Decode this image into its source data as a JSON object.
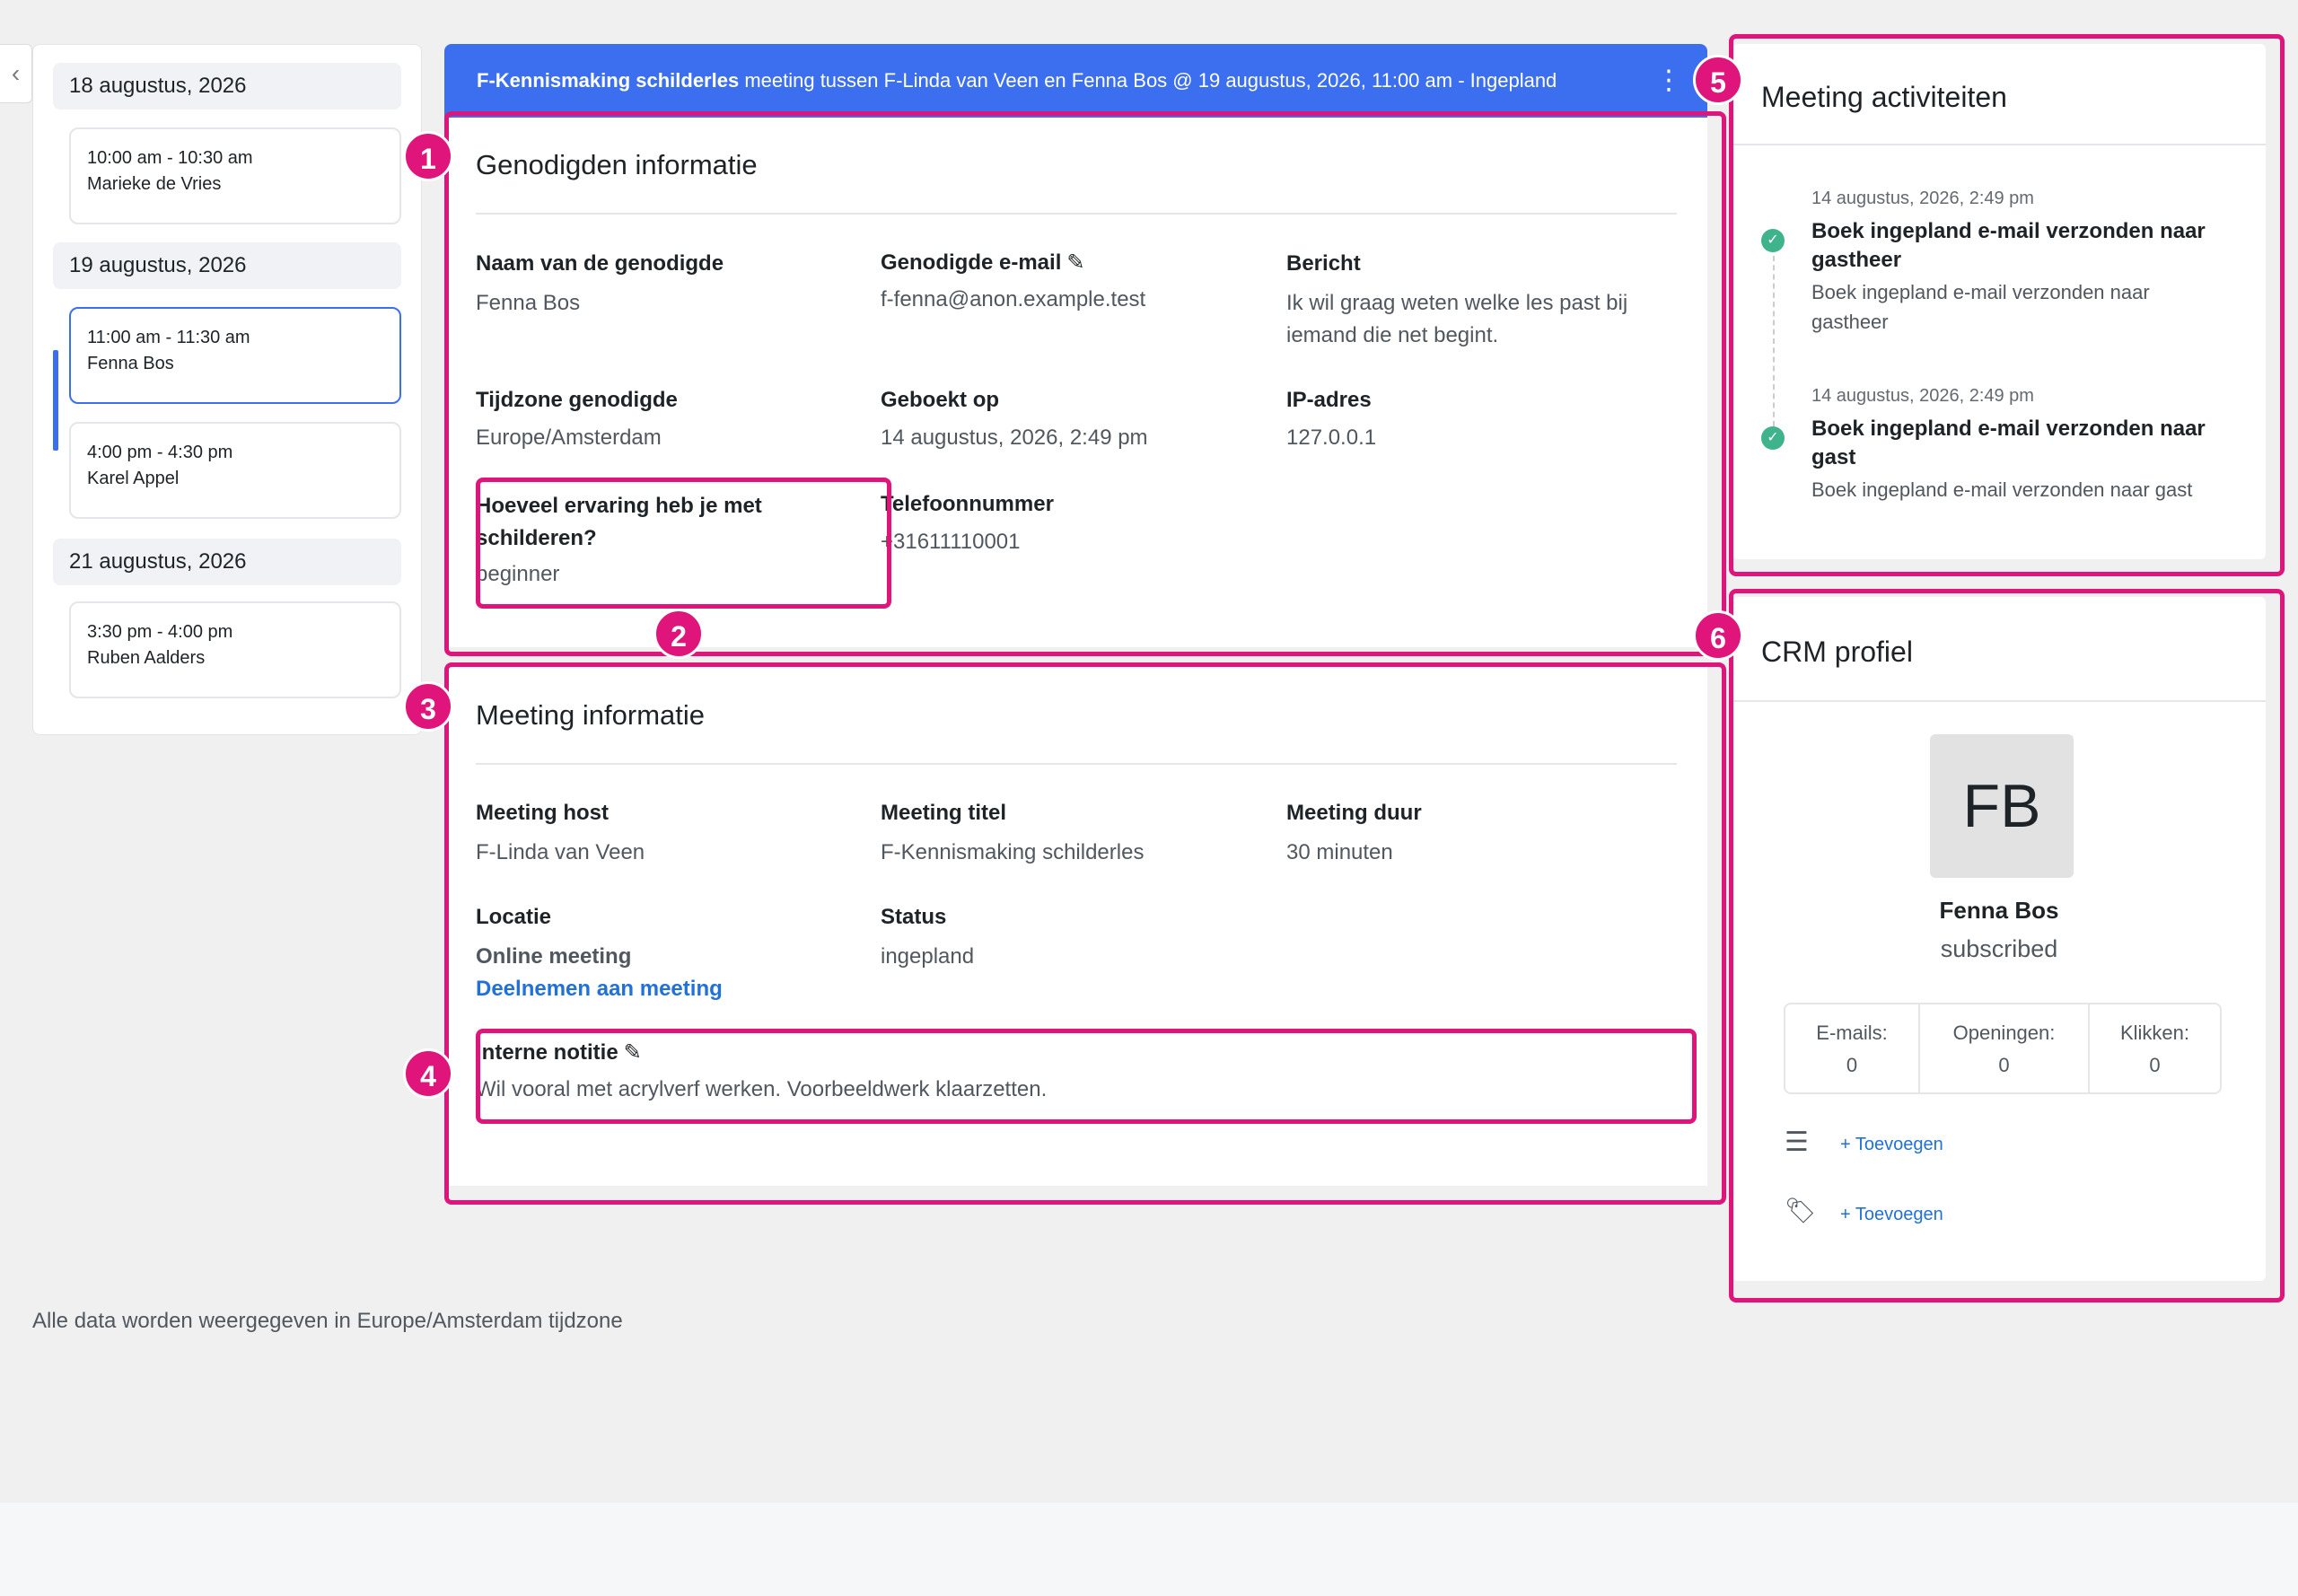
{
  "dates": [
    {
      "label": "18 augustus, 2026",
      "slots": [
        {
          "time": "10:00 am - 10:30 am",
          "name": "Marieke de Vries"
        }
      ]
    },
    {
      "label": "19 augustus, 2026",
      "slots": [
        {
          "time": "11:00 am - 11:30 am",
          "name": "Fenna Bos"
        },
        {
          "time": "4:00 pm - 4:30 pm",
          "name": "Karel Appel"
        }
      ]
    },
    {
      "label": "21 augustus, 2026",
      "slots": [
        {
          "time": "3:30 pm - 4:00 pm",
          "name": "Ruben Aalders"
        }
      ]
    }
  ],
  "header": {
    "title_bold": "F-Kennismaking schilderles",
    "title_rest": " meeting tussen F-Linda van Veen en Fenna Bos @ 19 augustus, 2026, 11:00 am - Ingepland",
    "menu_icon": "kebab-icon"
  },
  "invitee": {
    "title": "Genodigden informatie",
    "name_label": "Naam van de genodigde",
    "name": "Fenna Bos",
    "email_label": "Genodigde e-mail",
    "email": "f-fenna@anon.example.test",
    "message_label": "Bericht",
    "message": "Ik wil graag weten welke les past bij iemand die net begint.",
    "tz_label": "Tijdzone genodigde",
    "tz": "Europe/Amsterdam",
    "booked_label": "Geboekt op",
    "booked": "14 augustus, 2026, 2:49 pm",
    "ip_label": "IP-adres",
    "ip": "127.0.0.1",
    "q_label": "Hoeveel ervaring heb je met schilderen?",
    "q_answer": "beginner",
    "phone_label": "Telefoonnummer",
    "phone": "+31611110001"
  },
  "meeting": {
    "title": "Meeting informatie",
    "host_label": "Meeting host",
    "host": "F-Linda van Veen",
    "mtitle_label": "Meeting titel",
    "mtitle": "F-Kennismaking schilderles",
    "duration_label": "Meeting duur",
    "duration": "30 minuten",
    "location_label": "Locatie",
    "location": "Online meeting",
    "join_link": "Deelnemen aan meeting",
    "status_label": "Status",
    "status": "ingepland",
    "note_label": "Interne notitie",
    "note": "Wil vooral met acrylverf werken. Voorbeeldwerk klaarzetten."
  },
  "activities": {
    "title": "Meeting activiteiten",
    "items": [
      {
        "date": "14 augustus, 2026, 2:49 pm",
        "title_l1": "Boek ingepland e-mail verzonden naar",
        "title_l2": "gastheer",
        "desc_l1": "Boek ingepland e-mail verzonden naar",
        "desc_l2": "gastheer"
      },
      {
        "date": "14 augustus, 2026, 2:49 pm",
        "title_l1": "Boek ingepland e-mail verzonden naar",
        "title_l2": "gast",
        "desc_l1": "Boek ingepland e-mail verzonden naar gast",
        "desc_l2": ""
      }
    ]
  },
  "crm": {
    "title": "CRM profiel",
    "initials": "FB",
    "name": "Fenna Bos",
    "status": "subscribed",
    "stats": [
      {
        "label": "E-mails:",
        "value": "0"
      },
      {
        "label": "Openingen:",
        "value": "0"
      },
      {
        "label": "Klikken:",
        "value": "0"
      }
    ],
    "add_list": "+ Toevoegen",
    "add_tag": "+ Toevoegen",
    "list_icon": "list-icon",
    "tag_icon": "tag-icon"
  },
  "annotations": [
    "1",
    "2",
    "3",
    "4",
    "5",
    "6"
  ],
  "footer_note": "Alle data worden weergegeven in Europe/Amsterdam tijdzone",
  "colors": {
    "accent": "#3c6ff0",
    "highlight": "#e0157b",
    "success": "#3eb38c",
    "link": "#2271d8"
  }
}
